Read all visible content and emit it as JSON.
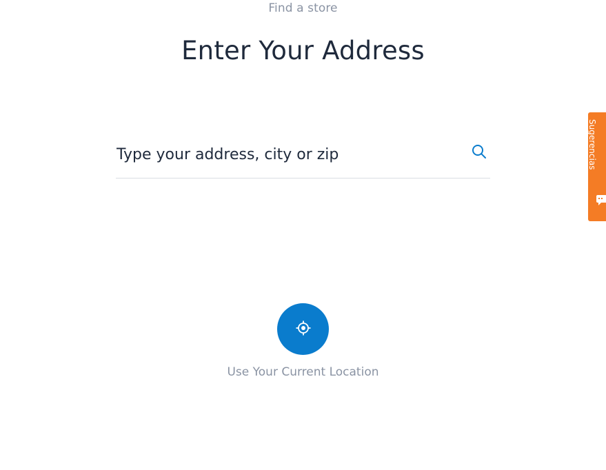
{
  "header": {
    "eyebrow": "Find a store",
    "title": "Enter Your Address"
  },
  "search": {
    "placeholder": "Type your address, city or zip",
    "value": "",
    "icon": "search-icon"
  },
  "location": {
    "label": "Use Your Current Location",
    "icon": "crosshair-icon"
  },
  "feedback_tab": {
    "label": "Sugerencias",
    "icon": "chat-icon"
  },
  "colors": {
    "accent": "#0a7ccd",
    "feedback": "#f47c25",
    "title_text": "#1f2a3c",
    "muted_text": "#8a93a3"
  }
}
